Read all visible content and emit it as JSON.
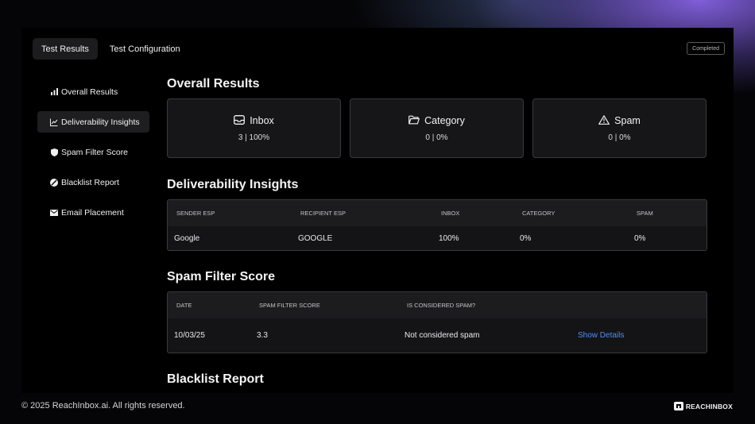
{
  "tabs": [
    {
      "label": "Test Results",
      "active": true
    },
    {
      "label": "Test Configuration",
      "active": false
    }
  ],
  "status_badge": "Completed",
  "sidebar": {
    "items": [
      {
        "label": "Overall Results",
        "icon": "bar-chart-icon",
        "active": false
      },
      {
        "label": "Deliverability Insights",
        "icon": "line-chart-icon",
        "active": true
      },
      {
        "label": "Spam Filter Score",
        "icon": "shield-icon",
        "active": false
      },
      {
        "label": "Blacklist Report",
        "icon": "ban-icon",
        "active": false
      },
      {
        "label": "Email Placement",
        "icon": "mail-icon",
        "active": false
      }
    ]
  },
  "overall": {
    "title": "Overall Results",
    "cards": [
      {
        "label": "Inbox",
        "icon": "inbox-icon",
        "value": "3 | 100%"
      },
      {
        "label": "Category",
        "icon": "folder-icon",
        "value": "0 | 0%"
      },
      {
        "label": "Spam",
        "icon": "warning-icon",
        "value": "0 | 0%"
      }
    ]
  },
  "deliverability": {
    "title": "Deliverability Insights",
    "columns": [
      "Sender ESP",
      "Recipient ESP",
      "Inbox",
      "Category",
      "Spam"
    ],
    "rows": [
      [
        "Google",
        "GOOGLE",
        "100%",
        "0%",
        "0%"
      ]
    ]
  },
  "spam_filter": {
    "title": "Spam Filter Score",
    "columns": [
      "Date",
      "Spam Filter Score",
      "Is Considered Spam?"
    ],
    "rows": [
      {
        "date": "10/03/25",
        "score": "3.3",
        "spam": "Not considered spam",
        "action": "Show Details"
      }
    ]
  },
  "blacklist": {
    "title": "Blacklist Report"
  },
  "footer": {
    "copyright": "© 2025 ReachInbox.ai. All rights reserved."
  },
  "brand": {
    "name": "REACHINBOX"
  },
  "colors": {
    "accent": "#4f8df7",
    "panel": "#000000",
    "card": "#161618",
    "border": "#3a3a3e"
  }
}
